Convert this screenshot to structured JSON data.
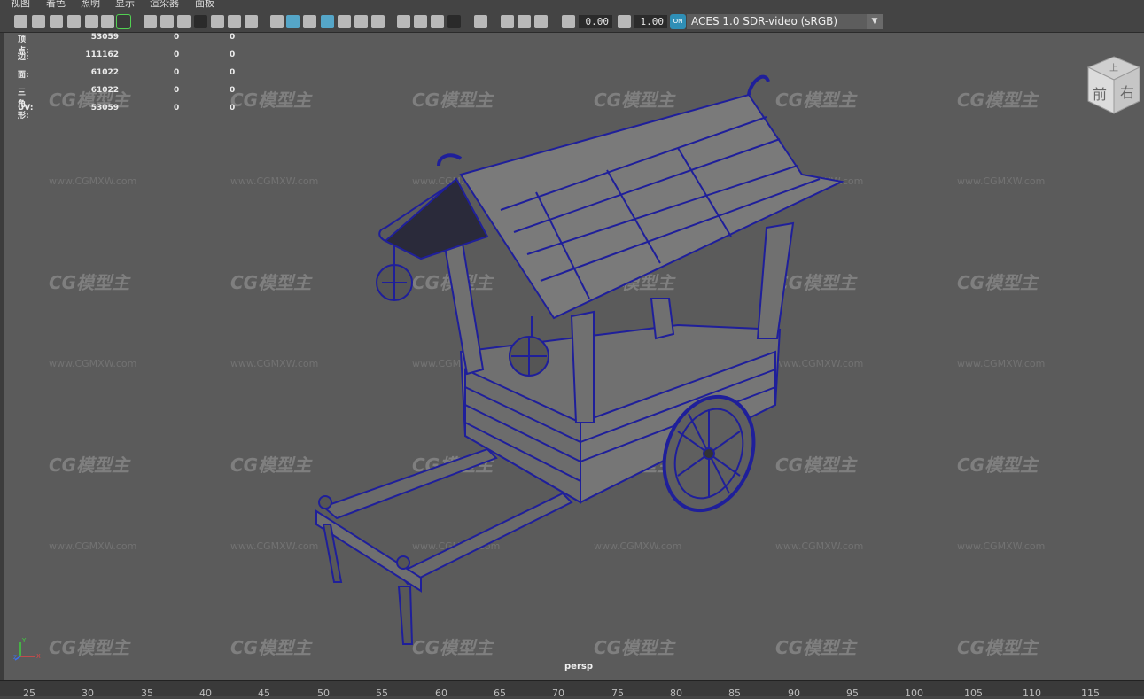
{
  "menu": [
    "视图",
    "着色",
    "照明",
    "显示",
    "渲染器",
    "面板"
  ],
  "toolbar": {
    "exposure_value": "0.00",
    "gamma_value": "1.00",
    "colorspace_button": "ON",
    "colorspace_label": "ACES 1.0 SDR-video (sRGB)",
    "icons": [
      "camera-icon",
      "bookmark-icon",
      "image-plane-icon",
      "grid-icon",
      "wireframe-icon",
      "smooth-shade-icon",
      "lights-icon",
      "shadows-icon",
      "isolate-icon",
      "xray-icon"
    ]
  },
  "heads_up": {
    "rows": [
      {
        "label": "顶点:",
        "v1": "53059",
        "v2": "0",
        "v3": "0"
      },
      {
        "label": "边:",
        "v1": "111162",
        "v2": "0",
        "v3": "0"
      },
      {
        "label": "面:",
        "v1": "61022",
        "v2": "0",
        "v3": "0"
      },
      {
        "label": "三角形:",
        "v1": "61022",
        "v2": "0",
        "v3": "0"
      },
      {
        "label": "UV:",
        "v1": "53059",
        "v2": "0",
        "v3": "0"
      }
    ]
  },
  "viewcube": {
    "top": "上",
    "front": "前",
    "right": "右"
  },
  "axis": {
    "y": "Y",
    "x": "X",
    "z": "Z"
  },
  "watermark": {
    "logo": "CG模型主",
    "url": "www.CGMXW.com"
  },
  "camera_label": "persp",
  "ruler": [
    "25",
    "30",
    "35",
    "40",
    "45",
    "50",
    "55",
    "60",
    "65",
    "70",
    "75",
    "80",
    "85",
    "90",
    "95",
    "100",
    "105",
    "110",
    "115"
  ],
  "colors": {
    "wire": "#1f1f9a",
    "viewport_bg": "#5b5b5b",
    "accent": "#55a6c8"
  }
}
